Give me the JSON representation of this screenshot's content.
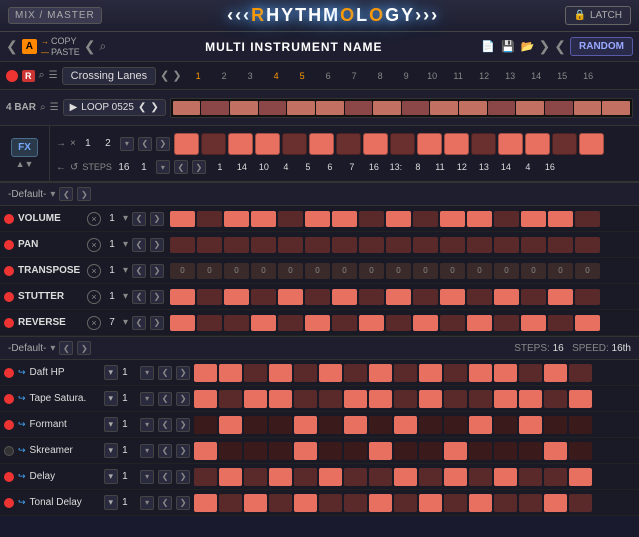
{
  "topbar": {
    "mix_master": "MIX / MASTER",
    "logo": "RHYTHMOLOGY",
    "latch": "LATCH"
  },
  "secondbar": {
    "a_badge": "A",
    "copy": "COPY",
    "paste": "PASTE",
    "instrument_name": "MULTI INSTRUMENT NAME",
    "random": "RANDOM"
  },
  "pattern": {
    "name": "Crossing Lanes",
    "steps": [
      "1",
      "2",
      "3",
      "4",
      "5",
      "6",
      "7",
      "8",
      "9",
      "10",
      "11",
      "12",
      "13",
      "14",
      "15",
      "16"
    ]
  },
  "loop": {
    "bar": "4 BAR",
    "name": "LOOP 0525",
    "step_values": [
      "1",
      "14",
      "10",
      "4",
      "5",
      "6",
      "7",
      "16",
      "13:",
      "8",
      "11",
      "12",
      "13",
      "14",
      "4",
      "16"
    ]
  },
  "controls": {
    "arrow_right": "→",
    "x_sym": "×",
    "arrow_left": "←",
    "rotate": "↻",
    "val1": "1",
    "val2": "2",
    "steps": "STEPS",
    "steps_val": "16"
  },
  "params": {
    "default_label": "-Default-",
    "items": [
      {
        "name": "VOLUME",
        "val": "1",
        "blocks": [
          1,
          1,
          1,
          0,
          1,
          1,
          0,
          1,
          1,
          0,
          1,
          1,
          1,
          0,
          1,
          1
        ]
      },
      {
        "name": "PAN",
        "val": "1",
        "blocks": [
          0,
          0,
          0,
          0,
          0,
          0,
          0,
          0,
          0,
          0,
          0,
          0,
          0,
          0,
          0,
          0
        ]
      },
      {
        "name": "TRANSPOSE",
        "val": "1",
        "zeros": [
          "0",
          "0",
          "0",
          "0",
          "0",
          "0",
          "0",
          "0",
          "0",
          "0",
          "0",
          "0",
          "0",
          "0",
          "0",
          "0"
        ]
      },
      {
        "name": "STUTTER",
        "val": "1",
        "blocks": [
          1,
          0,
          1,
          0,
          1,
          0,
          1,
          0,
          1,
          0,
          1,
          0,
          1,
          0,
          1,
          0
        ]
      },
      {
        "name": "REVERSE",
        "val": "7",
        "blocks": [
          1,
          0,
          0,
          1,
          0,
          1,
          0,
          1,
          0,
          1,
          0,
          1,
          0,
          1,
          0,
          1
        ]
      }
    ]
  },
  "effects": {
    "default_label": "-Default-",
    "steps_label": "STEPS:",
    "steps_val": "16",
    "speed_label": "SPEED:",
    "speed_val": "16th",
    "items": [
      {
        "name": "Daft HP",
        "active": true,
        "val": "1",
        "blocks": [
          1,
          1,
          0,
          1,
          0,
          1,
          0,
          1,
          0,
          1,
          0,
          1,
          1,
          0,
          1,
          0
        ]
      },
      {
        "name": "Tape Satura.",
        "active": true,
        "val": "1",
        "blocks": [
          1,
          0,
          1,
          1,
          0,
          0,
          1,
          1,
          0,
          1,
          0,
          0,
          1,
          1,
          0,
          1
        ]
      },
      {
        "name": "Formant",
        "active": true,
        "val": "1",
        "blocks": [
          0,
          1,
          0,
          0,
          1,
          0,
          1,
          0,
          1,
          0,
          0,
          1,
          0,
          1,
          0,
          0
        ]
      },
      {
        "name": "Skreamer",
        "active": false,
        "val": "1",
        "blocks": [
          1,
          0,
          0,
          0,
          1,
          0,
          0,
          1,
          0,
          0,
          1,
          0,
          0,
          0,
          1,
          0
        ]
      },
      {
        "name": "Delay",
        "active": true,
        "val": "1",
        "blocks": [
          0,
          1,
          0,
          1,
          0,
          1,
          0,
          0,
          1,
          0,
          1,
          0,
          1,
          0,
          0,
          1
        ]
      },
      {
        "name": "Tonal Delay",
        "active": true,
        "val": "1",
        "blocks": [
          1,
          0,
          1,
          0,
          1,
          0,
          0,
          1,
          0,
          1,
          0,
          1,
          0,
          0,
          1,
          0
        ]
      }
    ]
  }
}
